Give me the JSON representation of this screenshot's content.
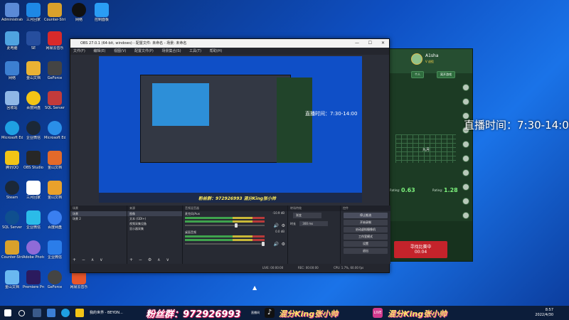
{
  "desktop": {
    "live_time_text": "直播时间：7:30-14:00",
    "icons": [
      {
        "label": "Administrator",
        "color": "#5b8ad6"
      },
      {
        "label": "三月回家",
        "color": "#1e88e5"
      },
      {
        "label": "此电脑",
        "color": "#4fa3e0"
      },
      {
        "label": "网络",
        "color": "#3c7fd1"
      },
      {
        "label": "控制面板",
        "color": "#2a9df4"
      },
      {
        "label": "回收站",
        "color": "#8fb7e6"
      },
      {
        "label": "Microsoft Edge",
        "color": "#1fa0e2"
      },
      {
        "label": "腾讯QQ",
        "color": "#f2c416"
      },
      {
        "label": "Steam",
        "color": "#1b2838"
      },
      {
        "label": "SQL Server",
        "color": "#c23b3b"
      },
      {
        "label": "Counter-Strike 2",
        "color": "#d9a12b"
      },
      {
        "label": "Adobe Photoshop",
        "color": "#2a8fe8"
      },
      {
        "label": "SE",
        "color": "#264e9e"
      },
      {
        "label": "金山文档",
        "color": "#e9b234"
      },
      {
        "label": "百度网盘",
        "color": "#3a7ff0"
      },
      {
        "label": "企业微信",
        "color": "#2b7de9"
      },
      {
        "label": "OBS Studio",
        "color": "#272727"
      },
      {
        "label": "网易云音乐",
        "color": "#d82a2a"
      },
      {
        "label": "Premiere Pro",
        "color": "#2b1a5e"
      },
      {
        "label": "GeForce",
        "color": "#444"
      }
    ]
  },
  "obs": {
    "title": "OBS 27.0.1 (64-bit, windows) - 配置文件: 未命名 - 场景: 未命名",
    "menu": [
      "文件(F)",
      "编辑(E)",
      "视图(V)",
      "配置文件(P)",
      "场景集合(S)",
      "工具(T)",
      "帮助(H)"
    ],
    "preview_time": "直播时间：7:30-14:00",
    "preview_fans": "粉丝群：972926993  混分King张小帅",
    "scenes_header": "场景",
    "scenes": [
      "场景",
      "场景 2"
    ],
    "sources_header": "来源",
    "sources": [
      "图像",
      "文本 (GDI+)",
      "视频采集设备",
      "显示器采集"
    ],
    "mixer_header": "音频混音器",
    "mixer_tracks": [
      {
        "name": "麦克风/Aux",
        "db": "-10.9 dB"
      },
      {
        "name": "桌面音频",
        "db": "0.0 dB"
      }
    ],
    "transition_header": "转场特效",
    "transition_type": "渐变",
    "transition_duration_label": "时长",
    "transition_duration": "300 ms",
    "controls_header": "控件",
    "controls": [
      "停止推流",
      "开始录制",
      "启动虚拟摄像机",
      "工作室模式",
      "设置",
      "退出"
    ],
    "status": {
      "live": "LIVE: 00:00:00",
      "rec": "REC: 00:00:00",
      "cpu": "CPU: 1.7%, 60.00 fps"
    }
  },
  "game": {
    "player_name": "A1sha",
    "player_level": "V 退役",
    "btn_left": "个人",
    "btn_right": "离开游戏",
    "round_label": "九月",
    "rating_left_label": "Rating:",
    "rating_left": "0.63",
    "rating_right_label": "Rating:",
    "rating_right": "1.28",
    "seek_label": "寻找比赛中",
    "seek_time": "00:04",
    "small_buttons": [
      "已选服务",
      "服务器",
      "已选专场"
    ]
  },
  "taskbar": {
    "start_label": "开始",
    "app_title": "我的世界 - BEYON...",
    "fans_text": "粉丝群：972926993",
    "fans_suffix": "直播间",
    "brand_1": "混分King张小帅",
    "brand_2": "混分King张小帅",
    "time": "8:57",
    "date": "2022/4/30"
  }
}
